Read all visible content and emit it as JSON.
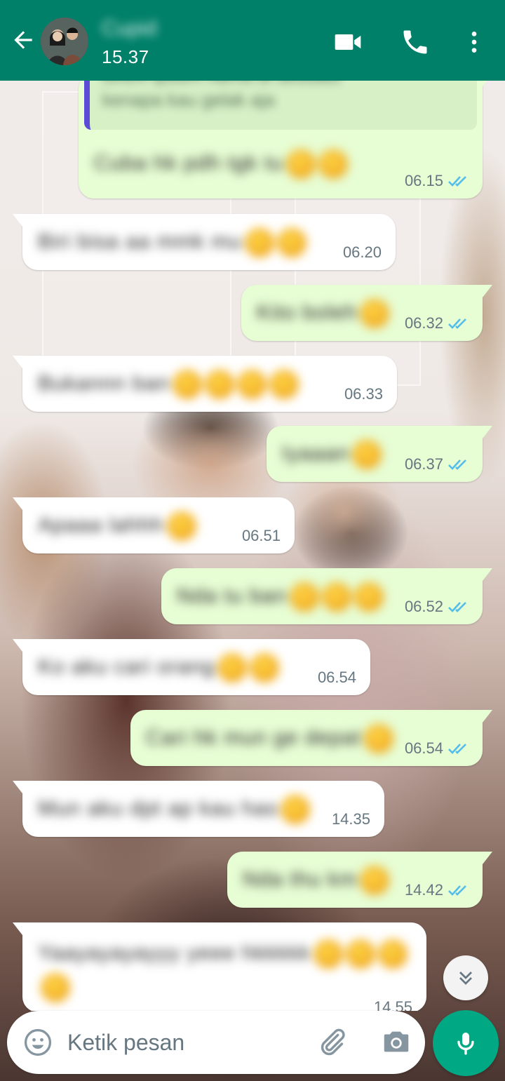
{
  "header": {
    "contact_name": "Cupid",
    "status": "15.37",
    "accent_color": "#008069"
  },
  "icons": {
    "back": "arrow-left-icon",
    "video": "video-camera-icon",
    "call": "phone-icon",
    "menu": "more-vertical-icon",
    "emoji": "emoji-icon",
    "attach": "paperclip-icon",
    "camera": "camera-icon",
    "mic": "microphone-icon",
    "scroll": "double-chevron-down-icon"
  },
  "messages": [
    {
      "direction": "out",
      "quote": [
        "lorem ipsum nama di sesuatu",
        "kenapa kau gelak aja"
      ],
      "text": "Cuba hk pdh tgk tu",
      "emojis": 2,
      "time": "06.15",
      "read": true
    },
    {
      "direction": "in",
      "text": "Biri bisa aa mmk mu",
      "emojis": 2,
      "time": "06.20"
    },
    {
      "direction": "out",
      "text": "Kito boleh",
      "emojis": 1,
      "time": "06.32",
      "read": true
    },
    {
      "direction": "in",
      "text": "Bukannn ban",
      "emojis": 4,
      "time": "06.33"
    },
    {
      "direction": "out",
      "text": "Iyaaan",
      "emojis": 1,
      "time": "06.37",
      "read": true
    },
    {
      "direction": "in",
      "text": "Apaaa lahhh",
      "emojis": 1,
      "time": "06.51"
    },
    {
      "direction": "out",
      "text": "Nda tu ban",
      "emojis": 3,
      "time": "06.52",
      "read": true
    },
    {
      "direction": "in",
      "text": "Ko aku cari orang",
      "emojis": 2,
      "time": "06.54"
    },
    {
      "direction": "out",
      "text": "Cari hk mun ge depat",
      "emojis": 1,
      "time": "06.54",
      "read": true
    },
    {
      "direction": "in",
      "text": "Mun aku dpt ap kau has",
      "emojis": 1,
      "time": "14.35"
    },
    {
      "direction": "out",
      "text": "Nda thu km",
      "emojis": 1,
      "time": "14.42",
      "read": true
    },
    {
      "direction": "in",
      "text": "Yaayayayayyy yeee hkkkkk",
      "emojis": 4,
      "time": "14.55"
    }
  ],
  "composer": {
    "placeholder": "Ketik pesan",
    "value": ""
  },
  "colors": {
    "outgoing_bubble": "#e7fdd4",
    "incoming_bubble": "#ffffff",
    "read_tick": "#53bdeb",
    "mic_button": "#00a884"
  }
}
